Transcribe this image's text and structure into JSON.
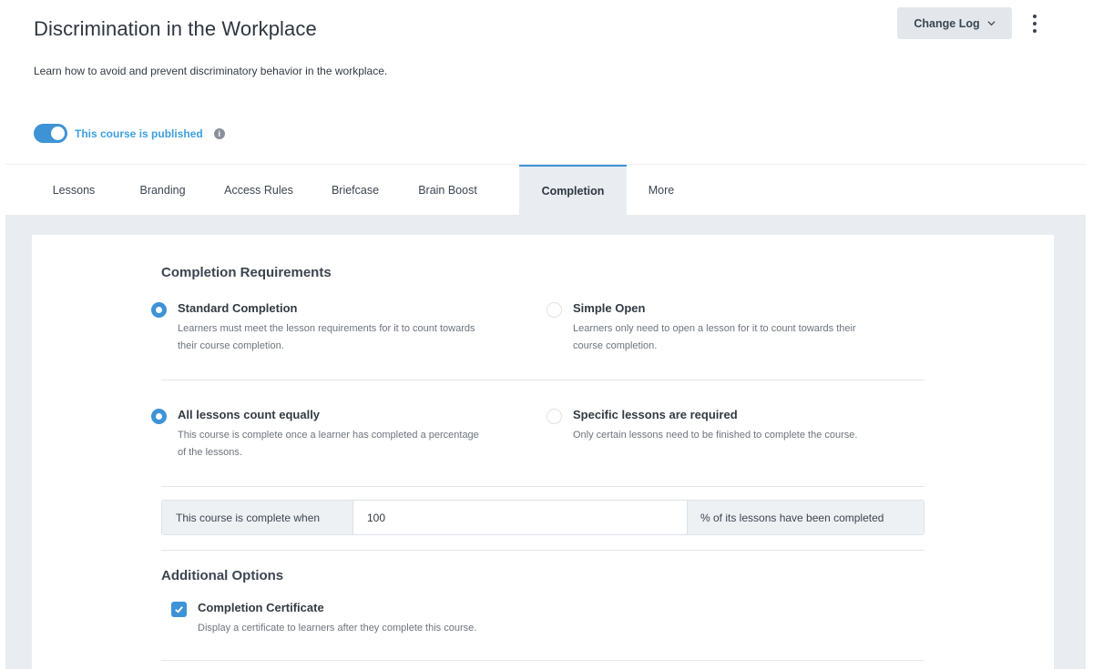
{
  "header": {
    "title": "Discrimination in the Workplace",
    "description": "Learn how to avoid and prevent discriminatory behavior in the workplace.",
    "changelog_label": "Change Log",
    "kebab_icon": "kebab-menu-icon"
  },
  "publish": {
    "enabled": true,
    "label": "This course is published",
    "info_glyph": "i"
  },
  "tabs": [
    {
      "label": "Lessons",
      "active": false
    },
    {
      "label": "Branding",
      "active": false
    },
    {
      "label": "Access Rules",
      "active": false
    },
    {
      "label": "Briefcase",
      "active": false
    },
    {
      "label": "Brain Boost",
      "active": false
    },
    {
      "label": "Completion",
      "active": true
    },
    {
      "label": "More",
      "active": false
    }
  ],
  "completion": {
    "title": "Completion Requirements",
    "standard": {
      "title": "Standard Completion",
      "desc1": "Learners must meet the lesson requirements for it to count towards",
      "desc2": "their course completion.",
      "selected": true
    },
    "simple": {
      "title": "Simple Open",
      "desc1": "Learners only need to open a lesson for it to count towards their",
      "desc2": "course completion.",
      "selected": false
    },
    "equal": {
      "title": "All lessons count equally",
      "desc1": "This course is complete once a learner has completed a percentage",
      "desc2": "of the lessons.",
      "selected": true
    },
    "specific": {
      "title": "Specific lessons are required",
      "desc1": "Only certain lessons need to be finished to complete the course.",
      "selected": false
    },
    "threshold": {
      "prefix": "This course is complete when",
      "value": "100",
      "suffix": "% of its lessons have been completed"
    }
  },
  "additional": {
    "title": "Additional Options",
    "certificate": {
      "title": "Completion Certificate",
      "desc": "Display a certificate to learners after they complete this course.",
      "checked": true
    }
  },
  "colors": {
    "accent": "#3d93d6",
    "publish_text": "#3d9fe0",
    "panel_bg": "#e9edf1"
  }
}
